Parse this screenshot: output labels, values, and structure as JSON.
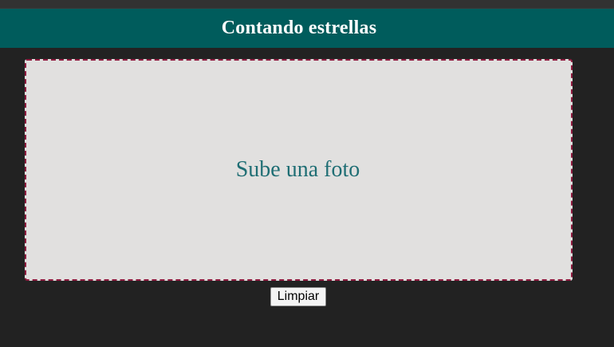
{
  "header": {
    "title": "Contando estrellas"
  },
  "upload": {
    "label": "Sube una foto"
  },
  "actions": {
    "clear_label": "Limpiar"
  },
  "colors": {
    "background": "#222222",
    "header_bg": "#005c5c",
    "dropzone_bg": "#e1e0df",
    "dropzone_border": "#8e1b3f",
    "dropzone_text": "#1f6e74"
  }
}
